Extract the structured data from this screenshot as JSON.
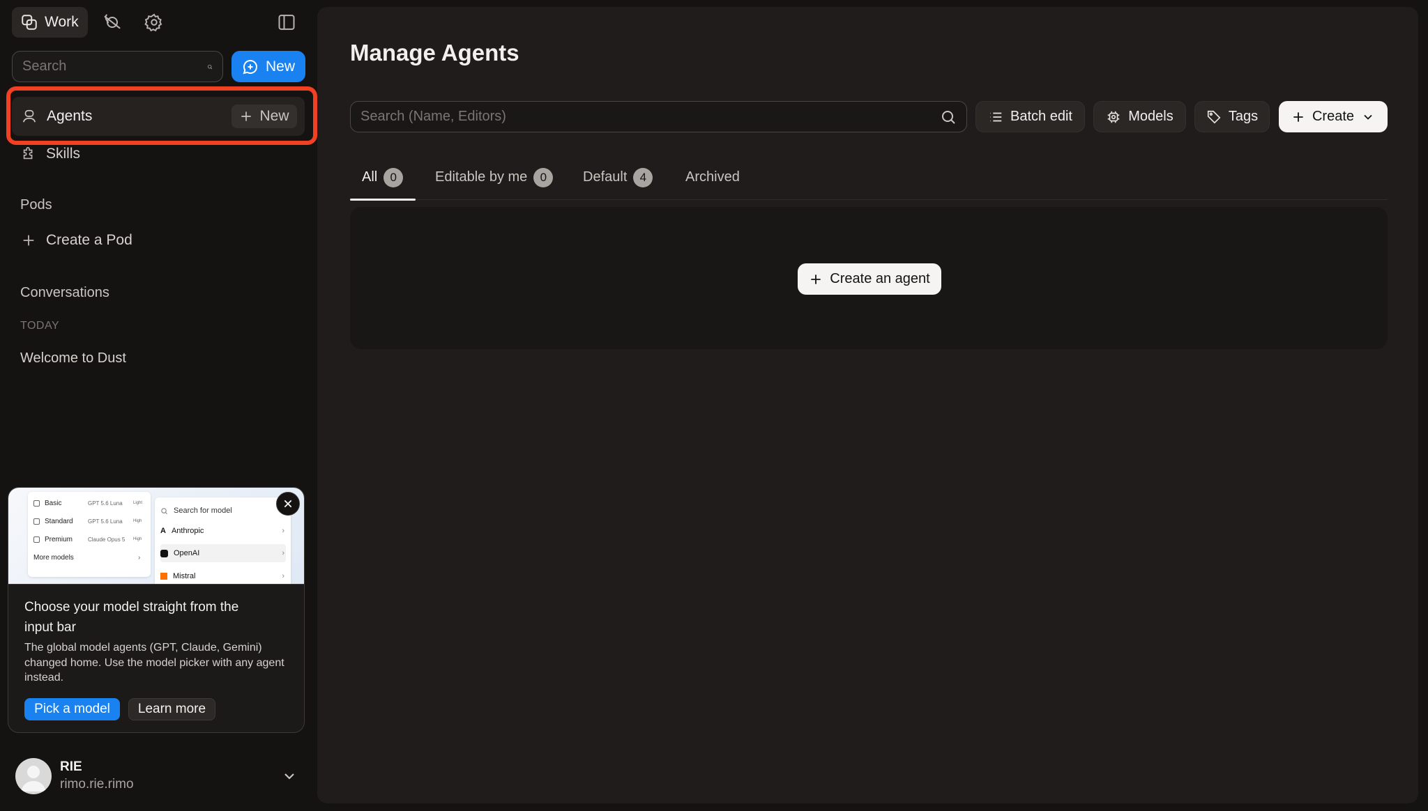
{
  "sidebar": {
    "work_tab": "Work",
    "search_placeholder": "Search",
    "new_label": "New",
    "agents": {
      "label": "Agents",
      "new_label": "New"
    },
    "skills_label": "Skills",
    "pods": {
      "heading": "Pods",
      "create_label": "Create a Pod"
    },
    "conversations": {
      "heading": "Conversations",
      "group": "TODAY",
      "items": [
        "Welcome to Dust"
      ]
    },
    "promo": {
      "preview": {
        "tiers": [
          {
            "name": "Basic",
            "model": "GPT 5.6 Luna",
            "tag": "Light"
          },
          {
            "name": "Standard",
            "model": "GPT 5.6 Luna",
            "tag": "High"
          },
          {
            "name": "Premium",
            "model": "Claude Opus 5",
            "tag": "High"
          }
        ],
        "more_models": "More models",
        "search_placeholder": "Search for model",
        "providers": [
          "Anthropic",
          "OpenAI",
          "Mistral"
        ]
      },
      "title": "Choose your model straight from the input bar",
      "body": "The global model agents (GPT, Claude, Gemini) changed home. Use the model picker with any agent instead.",
      "primary_label": "Pick a model",
      "secondary_label": "Learn more"
    },
    "user": {
      "name": "RIE",
      "handle": "rimo.rie.rimo"
    }
  },
  "main": {
    "title": "Manage Agents",
    "search_placeholder": "Search (Name, Editors)",
    "toolbar": {
      "batch_edit": "Batch edit",
      "models": "Models",
      "tags": "Tags",
      "create": "Create"
    },
    "tabs": [
      {
        "label": "All",
        "count": "0"
      },
      {
        "label": "Editable by me",
        "count": "0"
      },
      {
        "label": "Default",
        "count": "4"
      },
      {
        "label": "Archived"
      }
    ],
    "empty_action": "Create an agent"
  },
  "colors": {
    "accent": "#1a82f0",
    "highlight": "#f24022",
    "background": "#151312",
    "panel": "#1f1c1b"
  }
}
